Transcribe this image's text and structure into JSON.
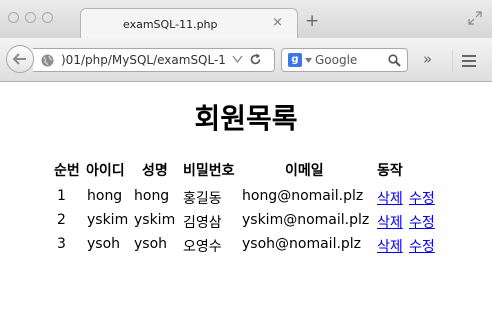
{
  "browser": {
    "tab_title": "examSQL-11.php",
    "tab_close": "×",
    "new_tab": "+",
    "url": ")01/php/MySQL/examSQL-1",
    "search_engine_letter": "g",
    "search_placeholder": "Google",
    "overflow": "»"
  },
  "page": {
    "title": "회원목록"
  },
  "table": {
    "headers": [
      "순번",
      "아이디",
      "성명",
      "비밀번호",
      "이메일",
      "동작"
    ],
    "rows": [
      {
        "no": "1",
        "id": "hong",
        "name": "hong",
        "password": "홍길동",
        "email": "hong@nomail.plz",
        "delete": "삭제",
        "edit": "수정"
      },
      {
        "no": "2",
        "id": "yskim",
        "name": "yskim",
        "password": "김영삼",
        "email": "yskim@nomail.plz",
        "delete": "삭제",
        "edit": "수정"
      },
      {
        "no": "3",
        "id": "ysoh",
        "name": "ysoh",
        "password": "오영수",
        "email": "ysoh@nomail.plz",
        "delete": "삭제",
        "edit": "수정"
      }
    ]
  }
}
